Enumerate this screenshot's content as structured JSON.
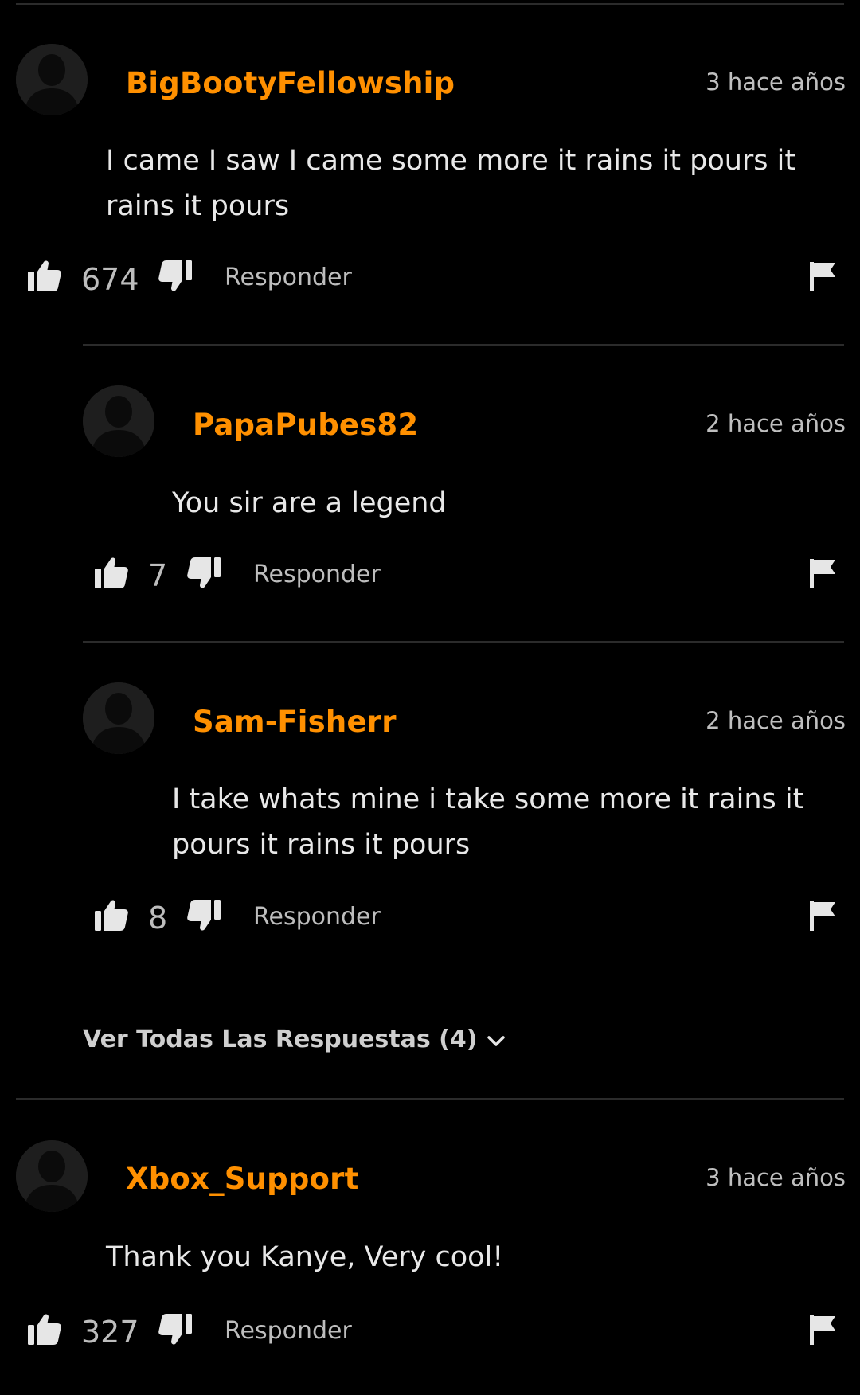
{
  "comments": [
    {
      "username": "BigBootyFellowship",
      "time": "3 hace años",
      "text": "I came I saw I came some more it rains it pours it rains it pours",
      "likes": "674",
      "reply_label": "Responder"
    },
    {
      "username": "PapaPubes82",
      "time": "2 hace años",
      "text": "You sir are a legend",
      "likes": "7",
      "reply_label": "Responder"
    },
    {
      "username": "Sam-Fisherr",
      "time": "2 hace años",
      "text": "I take whats mine i take some more it rains it pours it rains it pours",
      "likes": "8",
      "reply_label": "Responder"
    },
    {
      "username": "Xbox_Support",
      "time": "3 hace años",
      "text": "Thank you Kanye, Very cool!",
      "likes": "327",
      "reply_label": "Responder"
    }
  ],
  "view_all_replies": "Ver Todas Las Respuestas (4)",
  "icons": {
    "like": "thumbs-up-icon",
    "dislike": "thumbs-down-icon",
    "flag": "flag-icon",
    "avatar": "user-silhouette-icon",
    "expand": "chevron-down-icon"
  },
  "colors": {
    "background": "#000000",
    "username": "#ff9000",
    "text": "#e8e8e8",
    "muted": "#bdbdbd",
    "divider": "#2b2b2b"
  }
}
